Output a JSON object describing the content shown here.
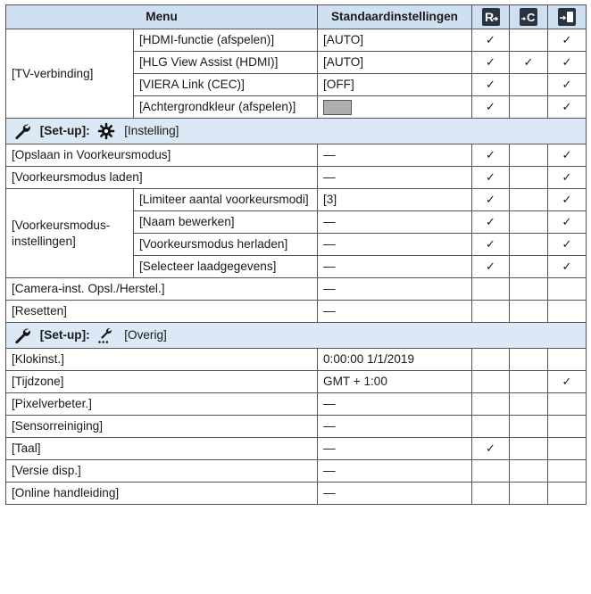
{
  "header": {
    "menu": "Menu",
    "default": "Standaardinstellingen",
    "icons": [
      "mode-r-icon",
      "mode-c-icon",
      "mode-save-icon"
    ]
  },
  "tv": {
    "group": "[TV-verbinding]",
    "rows": [
      {
        "label": "[HDMI-functie (afspelen)]",
        "value": "[AUTO]",
        "checks": [
          true,
          false,
          true
        ]
      },
      {
        "label": "[HLG View Assist (HDMI)]",
        "value": "[AUTO]",
        "checks": [
          true,
          true,
          true
        ]
      },
      {
        "label": "[VIERA Link (CEC)]",
        "value": "[OFF]",
        "checks": [
          true,
          false,
          true
        ]
      },
      {
        "label": "[Achtergrondkleur (afspelen)]",
        "value_swatch": "#aeaeae",
        "checks": [
          true,
          false,
          true
        ]
      }
    ]
  },
  "section1": {
    "bold": "[Set-up]:",
    "label": "[Instelling]",
    "icons": [
      "wrench-icon",
      "gear-icon"
    ]
  },
  "setup": {
    "row1": {
      "label": "[Opslaan in Voorkeursmodus]",
      "value": "—",
      "checks": [
        true,
        false,
        true
      ]
    },
    "row2": {
      "label": "[Voorkeursmodus laden]",
      "value": "—",
      "checks": [
        true,
        false,
        true
      ]
    },
    "group": "[Voorkeursmodus-instellingen]",
    "sub": [
      {
        "label": "[Limiteer aantal voorkeursmodi]",
        "value": "[3]",
        "checks": [
          true,
          false,
          true
        ]
      },
      {
        "label": "[Naam bewerken]",
        "value": "—",
        "checks": [
          true,
          false,
          true
        ]
      },
      {
        "label": "[Voorkeursmodus herladen]",
        "value": "—",
        "checks": [
          true,
          false,
          true
        ]
      },
      {
        "label": "[Selecteer laadgegevens]",
        "value": "—",
        "checks": [
          true,
          false,
          true
        ]
      }
    ],
    "row3": {
      "label": "[Camera-inst. Opsl./Herstel.]",
      "value": "—",
      "checks": [
        false,
        false,
        false
      ]
    },
    "row4": {
      "label": "[Resetten]",
      "value": "—",
      "checks": [
        false,
        false,
        false
      ]
    }
  },
  "section2": {
    "bold": "[Set-up]:",
    "label": "[Overig]",
    "icons": [
      "wrench-icon",
      "tools-icon"
    ]
  },
  "other": [
    {
      "label": "[Klokinst.]",
      "value": "0:00:00 1/1/2019",
      "checks": [
        false,
        false,
        false
      ]
    },
    {
      "label": "[Tijdzone]",
      "value": "GMT + 1:00",
      "checks": [
        false,
        false,
        true
      ]
    },
    {
      "label": "[Pixelverbeter.]",
      "value": "—",
      "checks": [
        false,
        false,
        false
      ]
    },
    {
      "label": "[Sensorreiniging]",
      "value": "—",
      "checks": [
        false,
        false,
        false
      ]
    },
    {
      "label": "[Taal]",
      "value": "—",
      "checks": [
        true,
        false,
        false
      ]
    },
    {
      "label": "[Versie disp.]",
      "value": "—",
      "checks": [
        false,
        false,
        false
      ]
    },
    {
      "label": "[Online handleiding]",
      "value": "—",
      "checks": [
        false,
        false,
        false
      ]
    }
  ],
  "check_mark": "✓",
  "colors": {
    "header_bg": "#cfe1f1",
    "section_bg": "#dbe8f5",
    "border": "#555555",
    "icon_bg": "#2a3440"
  }
}
